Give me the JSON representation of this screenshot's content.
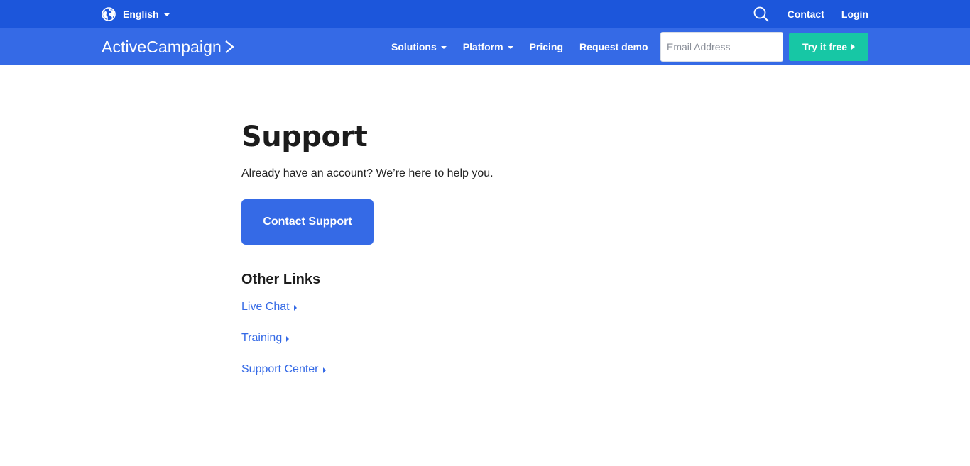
{
  "topbar": {
    "language_label": "English",
    "language_icon": "globe-icon",
    "search_icon": "search-icon",
    "links": [
      "Contact",
      "Login"
    ]
  },
  "navbar": {
    "logo_text": "ActiveCampaign",
    "logo_icon": "chevron-right-icon",
    "items": [
      {
        "label": "Solutions"
      },
      {
        "label": "Platform"
      },
      {
        "label": "Pricing"
      },
      {
        "label": "Request demo"
      }
    ],
    "email_placeholder": "Email Address",
    "cta_label": "Try it free"
  },
  "main": {
    "title": "Support",
    "subtitle": "Already have an account? We’re here to help you.",
    "contact_button": "Contact Support",
    "other_links_title": "Other Links",
    "links": [
      {
        "label": "Live Chat"
      },
      {
        "label": "Training"
      },
      {
        "label": "Support Center"
      }
    ]
  },
  "colors": {
    "topbar_bg": "#1c56db",
    "navbar_bg": "#356ae6",
    "cta_bg": "#17c7a5",
    "link": "#356ae6"
  }
}
